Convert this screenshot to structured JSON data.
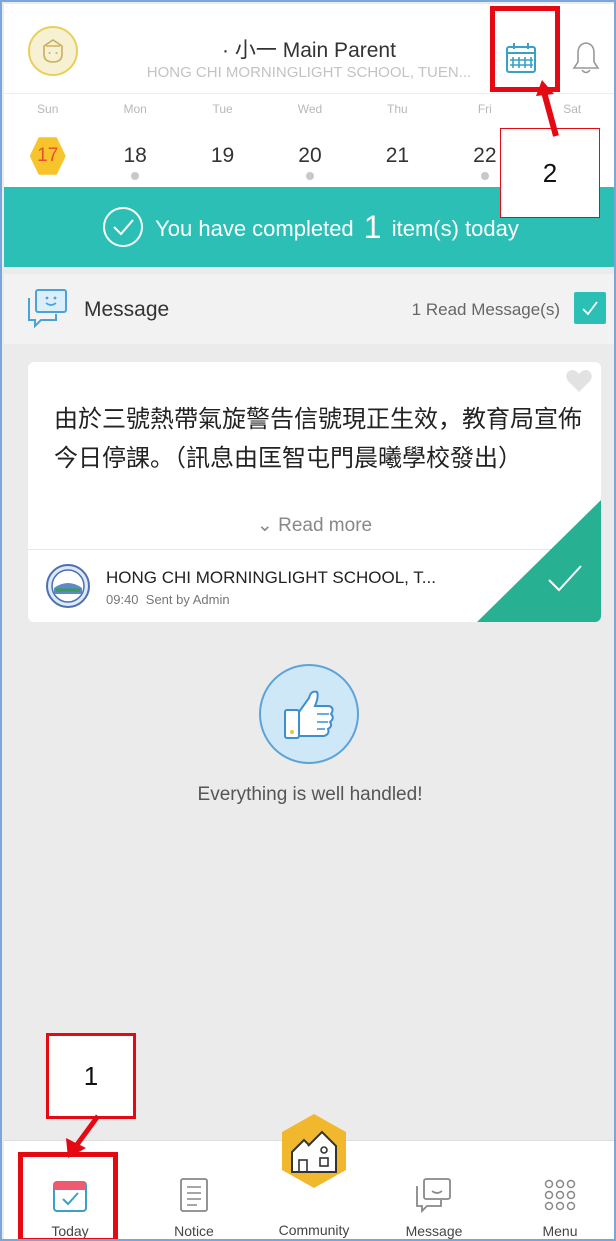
{
  "header": {
    "user_title": "· 小一  Main Parent",
    "school_name": "HONG CHI MORNINGLIGHT SCHOOL, TUEN..."
  },
  "calendar": {
    "weekdays": [
      "Sun",
      "Mon",
      "Tue",
      "Wed",
      "Thu",
      "Fri",
      "Sat"
    ],
    "dates": [
      "17",
      "18",
      "19",
      "20",
      "21",
      "22",
      ""
    ],
    "today_index": 0,
    "has_dot": [
      false,
      true,
      false,
      true,
      false,
      true,
      false
    ]
  },
  "banner": {
    "prefix": "You have completed",
    "count": "1",
    "suffix": "item(s) today"
  },
  "message_section": {
    "label": "Message",
    "read_count": "1 Read Message(s)"
  },
  "message_card": {
    "content": "由於三號熱帶氣旋警告信號現正生效，教育局宣佈今日停課。（訊息由匡智屯門晨曦學校發出）",
    "read_more": "Read more",
    "sender": "HONG CHI MORNINGLIGHT SCHOOL, T...",
    "time": "09:40",
    "sent_by": "Sent by Admin"
  },
  "empty_state": {
    "text": "Everything is well handled!"
  },
  "bottom_nav": {
    "items": [
      "Today",
      "Notice",
      "Community",
      "Message",
      "Menu"
    ],
    "active": "Today"
  },
  "annotations": {
    "label_1": "1",
    "label_2": "2"
  },
  "colors": {
    "teal": "#2bbfb5",
    "accent_red": "#e50914",
    "today_hex": "#f7c42c"
  }
}
